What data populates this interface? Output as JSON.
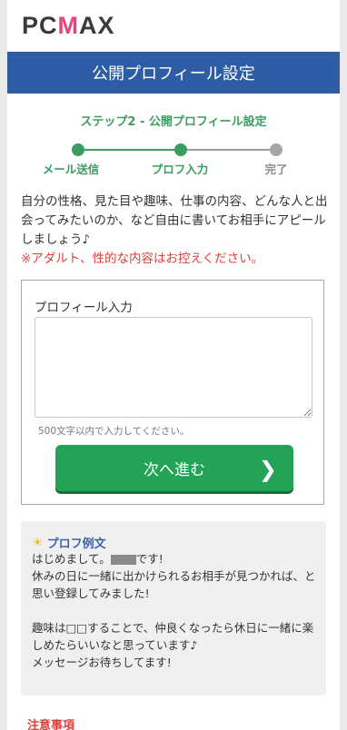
{
  "brand": {
    "logo_pre": "PC",
    "logo_accent": "M",
    "logo_post": "AX"
  },
  "header": {
    "title": "公開プロフィール設定"
  },
  "stepper": {
    "title": "ステップ2 - 公開プロフィール設定",
    "steps": [
      {
        "label": "メール送信",
        "status": "done"
      },
      {
        "label": "プロフ入力",
        "status": "current"
      },
      {
        "label": "完了",
        "status": "pending"
      }
    ]
  },
  "intro": {
    "text": "自分の性格、見た目や趣味、仕事の内容、どんな人と出会ってみたいのか、など自由に書いてお相手にアピールしましょう♪",
    "warning": "※アダルト、性的な内容はお控えください。"
  },
  "form": {
    "label": "プロフィール入力",
    "value": "",
    "hint": "500文字以内で入力してください。",
    "next_button": "次へ進む"
  },
  "example": {
    "title": "プロフ例文",
    "line1_pre": "はじめまして。",
    "line1_post": "です!",
    "body": "休みの日に一緒に出かけられるお相手が見つかれば、と思い登録してみました!\n\n趣味は□□することで、仲良くなったら休日に一緒に楽しめたらいいなと思っています♪\nメッセージお待ちしてます!"
  },
  "notice": {
    "title": "注意事項"
  },
  "colors": {
    "brand_blue": "#2e5ca5",
    "step_green": "#3c9c62",
    "button_green": "#23a356",
    "warning_red": "#e0403a",
    "logo_pink": "#e8437b"
  }
}
